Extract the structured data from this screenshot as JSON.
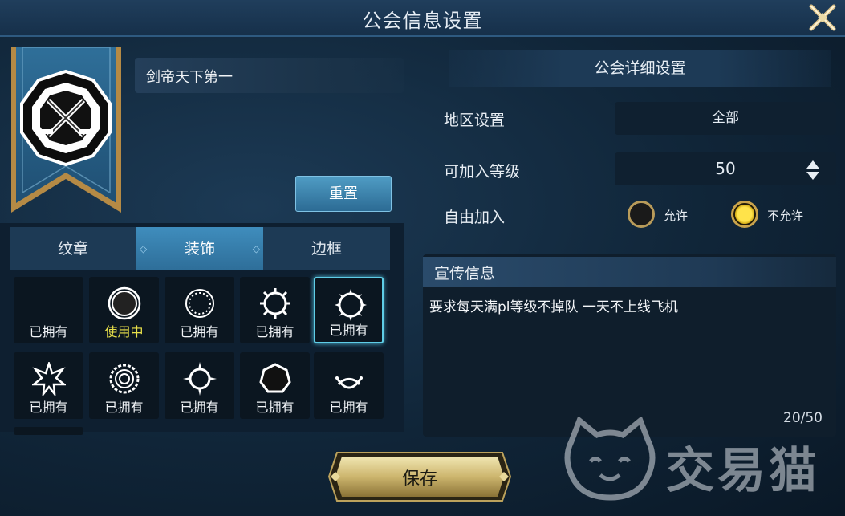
{
  "window": {
    "title": "公会信息设置"
  },
  "guild": {
    "name": "剑帝天下第一"
  },
  "buttons": {
    "reset": "重置",
    "save": "保存"
  },
  "tabs": [
    {
      "label": "纹章",
      "active": false
    },
    {
      "label": "装饰",
      "active": true
    },
    {
      "label": "边框",
      "active": false
    }
  ],
  "decorations": [
    {
      "status": "已拥有",
      "icon": "empty",
      "selected": false
    },
    {
      "status": "使用中",
      "icon": "double-ring",
      "selected": false
    },
    {
      "status": "已拥有",
      "icon": "dotted-ring",
      "selected": false
    },
    {
      "status": "已拥有",
      "icon": "sun-ring",
      "selected": false
    },
    {
      "status": "已拥有",
      "icon": "thorn-ring",
      "selected": true
    },
    {
      "status": "已拥有",
      "icon": "spiked-star-ring",
      "selected": false
    },
    {
      "status": "已拥有",
      "icon": "gear-ring",
      "selected": false
    },
    {
      "status": "已拥有",
      "icon": "star-ring",
      "selected": false
    },
    {
      "status": "已拥有",
      "icon": "heptagon-ring",
      "selected": false
    },
    {
      "status": "已拥有",
      "icon": "laurel-ring",
      "selected": false
    }
  ],
  "settings": {
    "header": "公会详细设置",
    "region_label": "地区设置",
    "region_value": "全部",
    "level_label": "可加入等级",
    "level_value": "50",
    "free_join_label": "自由加入",
    "allow_label": "允许",
    "disallow_label": "不允许",
    "free_join_selected": "disallow"
  },
  "promo": {
    "header": "宣传信息",
    "text": "要求每天满pl等级不掉队 一天不上线飞机",
    "count": "20/50"
  },
  "watermark": {
    "text": "交易猫"
  },
  "colors": {
    "accent": "#3f8dbd",
    "in_use": "#e8e04a",
    "selected_border": "#5fcde6",
    "gold": "#c9a34c"
  }
}
